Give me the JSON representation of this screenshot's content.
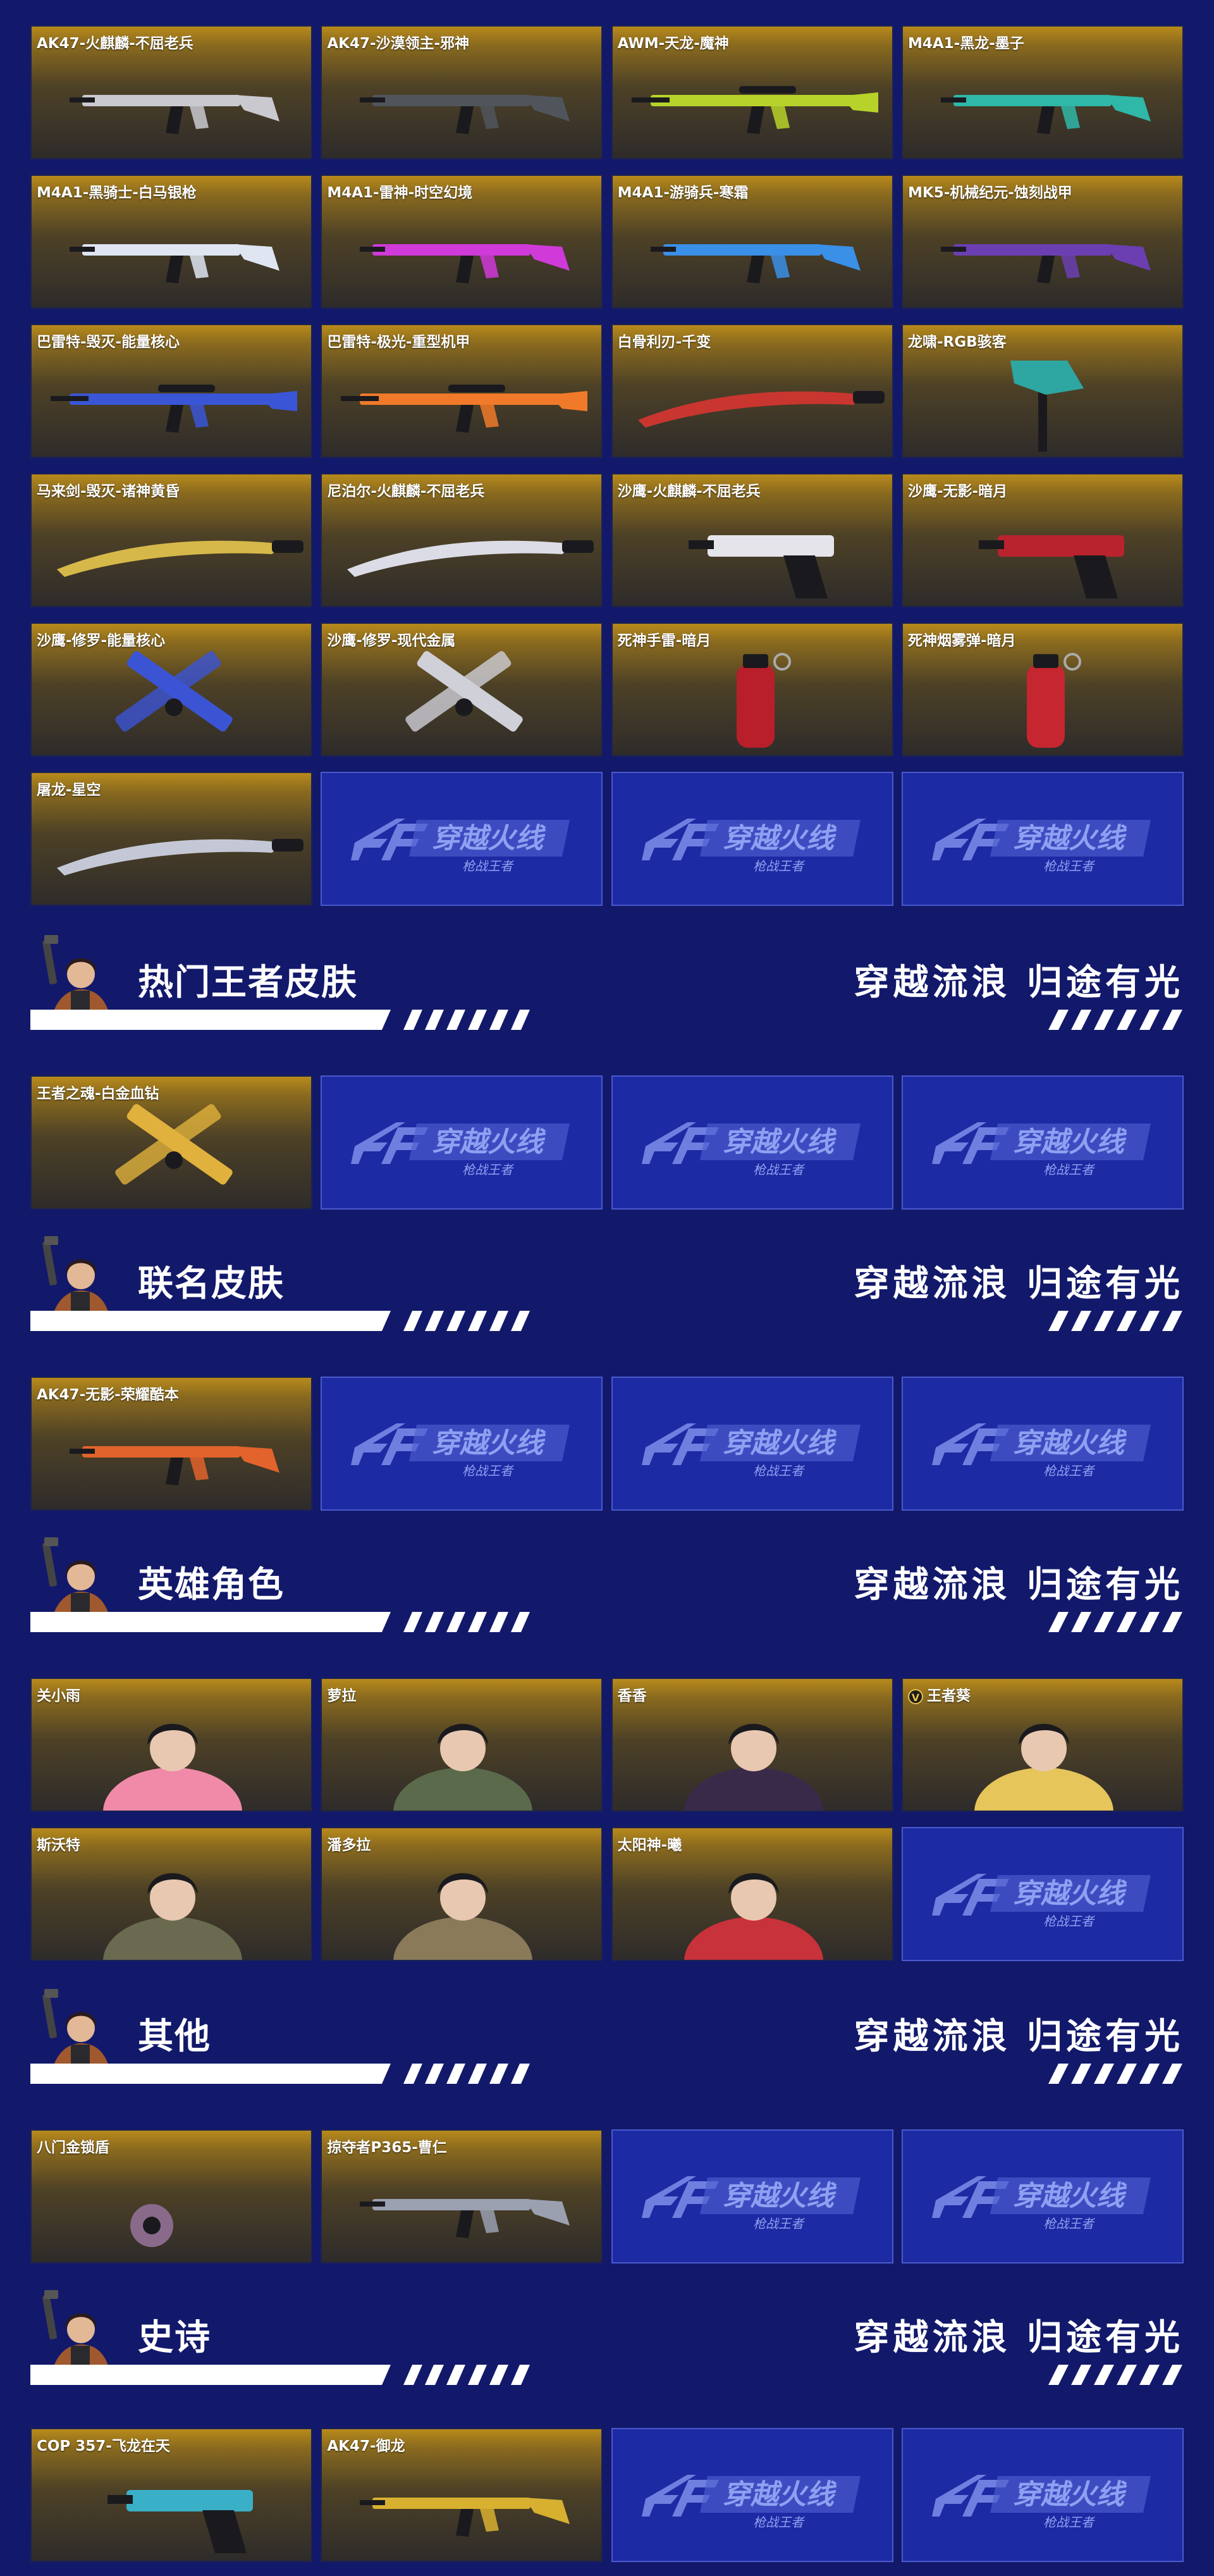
{
  "slogan": "穿越流浪 归途有光",
  "filler_logo": {
    "main": "穿越火线",
    "sub": "枪战王者"
  },
  "sections": {
    "hot_king": {
      "title": "热门王者皮肤"
    },
    "collab": {
      "title": "联名皮肤"
    },
    "heroes": {
      "title": "英雄角色"
    },
    "other": {
      "title": "其他"
    },
    "epic": {
      "title": "史诗"
    }
  },
  "weapons": [
    {
      "name": "AK47-火麒麟-不屈老兵",
      "icon": "rifle-icon",
      "color": "#c9c9cf"
    },
    {
      "name": "AK47-沙漠领主-邪神",
      "icon": "rifle-icon",
      "color": "#50555c"
    },
    {
      "name": "AWM-天龙-魔神",
      "icon": "sniper-rifle-icon",
      "color": "#b7d22a"
    },
    {
      "name": "M4A1-黑龙-墨子",
      "icon": "rifle-icon",
      "color": "#2fb7a8"
    },
    {
      "name": "M4A1-黑骑士-白马银枪",
      "icon": "rifle-icon",
      "color": "#dfe6f2"
    },
    {
      "name": "M4A1-雷神-时空幻境",
      "icon": "rifle-icon",
      "color": "#d03ad8"
    },
    {
      "name": "M4A1-游骑兵-寒霜",
      "icon": "rifle-icon",
      "color": "#3a8fe6"
    },
    {
      "name": "MK5-机械纪元-蚀刻战甲",
      "icon": "smg-icon",
      "color": "#6b3fb2"
    },
    {
      "name": "巴雷特-毁灭-能量核心",
      "icon": "sniper-rifle-icon",
      "color": "#3a56d6"
    },
    {
      "name": "巴雷特-极光-重型机甲",
      "icon": "sniper-rifle-icon",
      "color": "#f07a2a"
    },
    {
      "name": "白骨利刃-千变",
      "icon": "blade-icon",
      "color": "#c8362f"
    },
    {
      "name": "龙啸-RGB骇客",
      "icon": "axe-icon",
      "color": "#2ea6a1"
    },
    {
      "name": "马来剑-毁灭-诸神黄昏",
      "icon": "blade-icon",
      "color": "#d6b84a"
    },
    {
      "name": "尼泊尔-火麒麟-不屈老兵",
      "icon": "knife-icon",
      "color": "#dcdce6"
    },
    {
      "name": "沙鹰-火麒麟-不屈老兵",
      "icon": "pistol-icon",
      "color": "#e4e4ea"
    },
    {
      "name": "沙鹰-无影-暗月",
      "icon": "pistol-icon",
      "color": "#b8232e"
    },
    {
      "name": "沙鹰-修罗-能量核心",
      "icon": "dual-pistol-icon",
      "color": "#3b54d4"
    },
    {
      "name": "沙鹰-修罗-现代金属",
      "icon": "dual-pistol-icon",
      "color": "#cfd0d8"
    },
    {
      "name": "死神手雷-暗月",
      "icon": "grenade-icon",
      "color": "#b81f2a"
    },
    {
      "name": "死神烟雾弹-暗月",
      "icon": "grenade-icon",
      "color": "#c5262f"
    },
    {
      "name": "屠龙-星空",
      "icon": "blade-icon",
      "color": "#c4c8d6"
    }
  ],
  "hot_king_items": [
    {
      "name": "王者之魂-白金血钻",
      "icon": "dual-pistol-icon",
      "color": "#e0b13c"
    }
  ],
  "collab_items": [
    {
      "name": "AK47-无影-荣耀酷本",
      "icon": "rifle-icon",
      "color": "#e2632c"
    }
  ],
  "hero_items": [
    {
      "name": "关小雨",
      "icon": "character-icon",
      "color": "#f08aa8",
      "badge": ""
    },
    {
      "name": "萝拉",
      "icon": "character-icon",
      "color": "#5a6a4a",
      "badge": ""
    },
    {
      "name": "香香",
      "icon": "character-icon",
      "color": "#3a2a4a",
      "badge": ""
    },
    {
      "name": "王者葵",
      "icon": "character-icon",
      "color": "#e6c55a",
      "badge": "V"
    },
    {
      "name": "斯沃特",
      "icon": "character-icon",
      "color": "#6a6a50",
      "badge": ""
    },
    {
      "name": "潘多拉",
      "icon": "character-icon",
      "color": "#8a7a5a",
      "badge": ""
    },
    {
      "name": "太阳神-曦",
      "icon": "character-icon",
      "color": "#c8323a",
      "badge": ""
    }
  ],
  "other_items": [
    {
      "name": "八门金锁盾",
      "icon": "shield-icon",
      "color": "#8a6a8a"
    },
    {
      "name": "掠夺者P365-曹仁",
      "icon": "smg-icon",
      "color": "#9aa0b0"
    }
  ],
  "epic_items": [
    {
      "name": "COP 357-飞龙在天",
      "icon": "pistol-icon",
      "color": "#3ab0c8"
    },
    {
      "name": "AK47-御龙",
      "icon": "rifle-icon",
      "color": "#d8b030"
    }
  ]
}
